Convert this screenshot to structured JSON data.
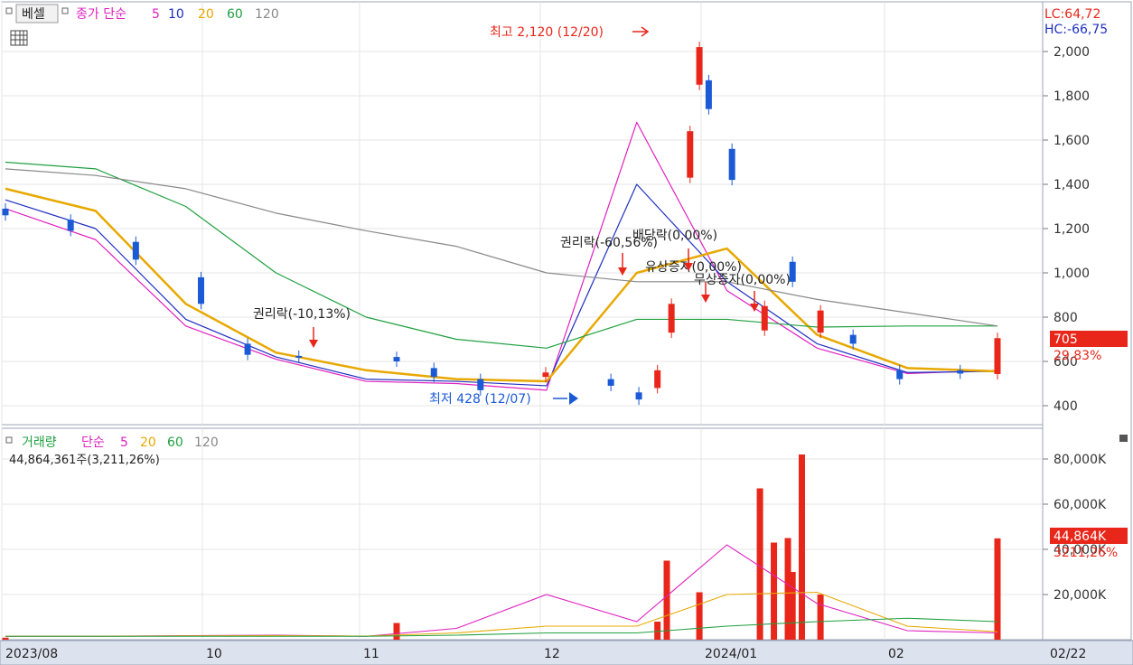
{
  "colors": {
    "up": "#e8261a",
    "down": "#1b5ad6",
    "ma5": "#e020c0",
    "ma10": "#2030c0",
    "ma20": "#e8a800",
    "ma60": "#20a040",
    "ma120": "#888888",
    "vol_ma5": "#e020c0",
    "vol_ma20": "#e8a800",
    "vol_ma60": "#20a040",
    "vol_ma120": "#888888"
  },
  "price_header": {
    "box_label": "베셀",
    "type_label": "종가 단순",
    "ma_periods": [
      "5",
      "10",
      "20",
      "60",
      "120"
    ],
    "table_icon": "table-icon"
  },
  "volume_header": {
    "label": "거래량",
    "type_label": "단순",
    "ma_periods": [
      "5",
      "20",
      "60",
      "120"
    ],
    "current_text": "44,864,361주(3,211,26%)"
  },
  "right_info": {
    "lc": "LC:64,72",
    "hc": "HC:-66,75"
  },
  "price_badge": {
    "value": "705",
    "change": "29,83%"
  },
  "volume_badge": {
    "value": "44,864K",
    "change": "3211,26%"
  },
  "x_labels": [
    "2023/08",
    "10",
    "11",
    "12",
    "2024/01",
    "02"
  ],
  "x_right_label": "02/22",
  "annotations": {
    "high": "최고 2,120 (12/20)",
    "low": "최저 428 (12/07)",
    "event1": "권리락(-10,13%)",
    "event2": "권리락(-60,56%)",
    "event3": "배당락(0,00%)",
    "event4": "유상증자(0,00%)",
    "event5": "무상증자(0,00%)"
  },
  "chart_data": [
    {
      "type": "candlestick",
      "ylim": [
        300,
        2200
      ],
      "y_ticks": [
        "2,000",
        "1,800",
        "1,600",
        "1,400",
        "1,200",
        "1,000",
        "800",
        "600",
        "400"
      ],
      "x_range": [
        "2023-07-24",
        "2024-02-22"
      ],
      "high": {
        "value": 2120,
        "date": "12/20"
      },
      "low": {
        "value": 428,
        "date": "12/07"
      },
      "last_close": 705,
      "last_change_pct": 29.83,
      "candles_approx": [
        {
          "date": "2023-07-24",
          "o": 1290,
          "c": 1260
        },
        {
          "date": "2023-08-07",
          "o": 1240,
          "c": 1190
        },
        {
          "date": "2023-08-21",
          "o": 1140,
          "c": 1060
        },
        {
          "date": "2023-09-04",
          "o": 980,
          "c": 860
        },
        {
          "date": "2023-09-14",
          "o": 680,
          "c": 630
        },
        {
          "date": "2023-09-25",
          "o": 625,
          "c": 620
        },
        {
          "date": "2023-10-16",
          "o": 620,
          "c": 600
        },
        {
          "date": "2023-10-24",
          "o": 570,
          "c": 530
        },
        {
          "date": "2023-11-03",
          "o": 520,
          "c": 470
        },
        {
          "date": "2023-11-17",
          "o": 530,
          "c": 550
        },
        {
          "date": "2023-12-01",
          "o": 520,
          "c": 490
        },
        {
          "date": "2023-12-07",
          "o": 460,
          "c": 428
        },
        {
          "date": "2023-12-11",
          "o": 480,
          "c": 560
        },
        {
          "date": "2023-12-14",
          "o": 730,
          "c": 860
        },
        {
          "date": "2023-12-18",
          "o": 1430,
          "c": 1640
        },
        {
          "date": "2023-12-20",
          "o": 1850,
          "c": 2020
        },
        {
          "date": "2023-12-22",
          "o": 1870,
          "c": 1740
        },
        {
          "date": "2023-12-27",
          "o": 1560,
          "c": 1420
        },
        {
          "date": "2024-01-03",
          "o": 740,
          "c": 850
        },
        {
          "date": "2024-01-09",
          "o": 1050,
          "c": 960
        },
        {
          "date": "2024-01-15",
          "o": 730,
          "c": 830
        },
        {
          "date": "2024-01-22",
          "o": 720,
          "c": 680
        },
        {
          "date": "2024-02-01",
          "o": 560,
          "c": 520
        },
        {
          "date": "2024-02-14",
          "o": 560,
          "c": 545
        },
        {
          "date": "2024-02-22",
          "o": 543,
          "c": 705
        }
      ],
      "series": [
        {
          "name": "5",
          "values_approx": [
            1290,
            1150,
            760,
            610,
            510,
            500,
            470,
            1680,
            920,
            660,
            545,
            560
          ]
        },
        {
          "name": "10",
          "values_approx": [
            1330,
            1200,
            790,
            620,
            520,
            510,
            490,
            1400,
            960,
            680,
            550,
            555
          ]
        },
        {
          "name": "20",
          "values_approx": [
            1380,
            1280,
            860,
            640,
            560,
            520,
            510,
            1000,
            1110,
            720,
            570,
            555
          ]
        },
        {
          "name": "60",
          "values_approx": [
            1500,
            1470,
            1300,
            1000,
            800,
            700,
            660,
            790,
            790,
            755,
            760,
            760
          ]
        },
        {
          "name": "120",
          "values_approx": [
            1470,
            1440,
            1380,
            1270,
            1190,
            1120,
            1000,
            960,
            960,
            880,
            820,
            760
          ]
        }
      ]
    },
    {
      "type": "bar",
      "ylim": [
        0,
        90000
      ],
      "y_unit": "K",
      "y_ticks": [
        "80,000K",
        "60,000K",
        "40,000K",
        "20,000K"
      ],
      "last_volume": 44864361,
      "last_change_pct": 3211.26,
      "bars_approx": [
        {
          "date": "2023-07-24",
          "v": 900
        },
        {
          "date": "2023-10-16",
          "v": 7400
        },
        {
          "date": "2023-12-11",
          "v": 8000
        },
        {
          "date": "2023-12-13",
          "v": 35000
        },
        {
          "date": "2023-12-20",
          "v": 21000
        },
        {
          "date": "2024-01-02",
          "v": 67000
        },
        {
          "date": "2024-01-05",
          "v": 43000
        },
        {
          "date": "2024-01-08",
          "v": 45000
        },
        {
          "date": "2024-01-09",
          "v": 30000
        },
        {
          "date": "2024-01-11",
          "v": 82000
        },
        {
          "date": "2024-01-15",
          "v": 20000
        },
        {
          "date": "2024-02-22",
          "v": 44864
        }
      ]
    }
  ]
}
